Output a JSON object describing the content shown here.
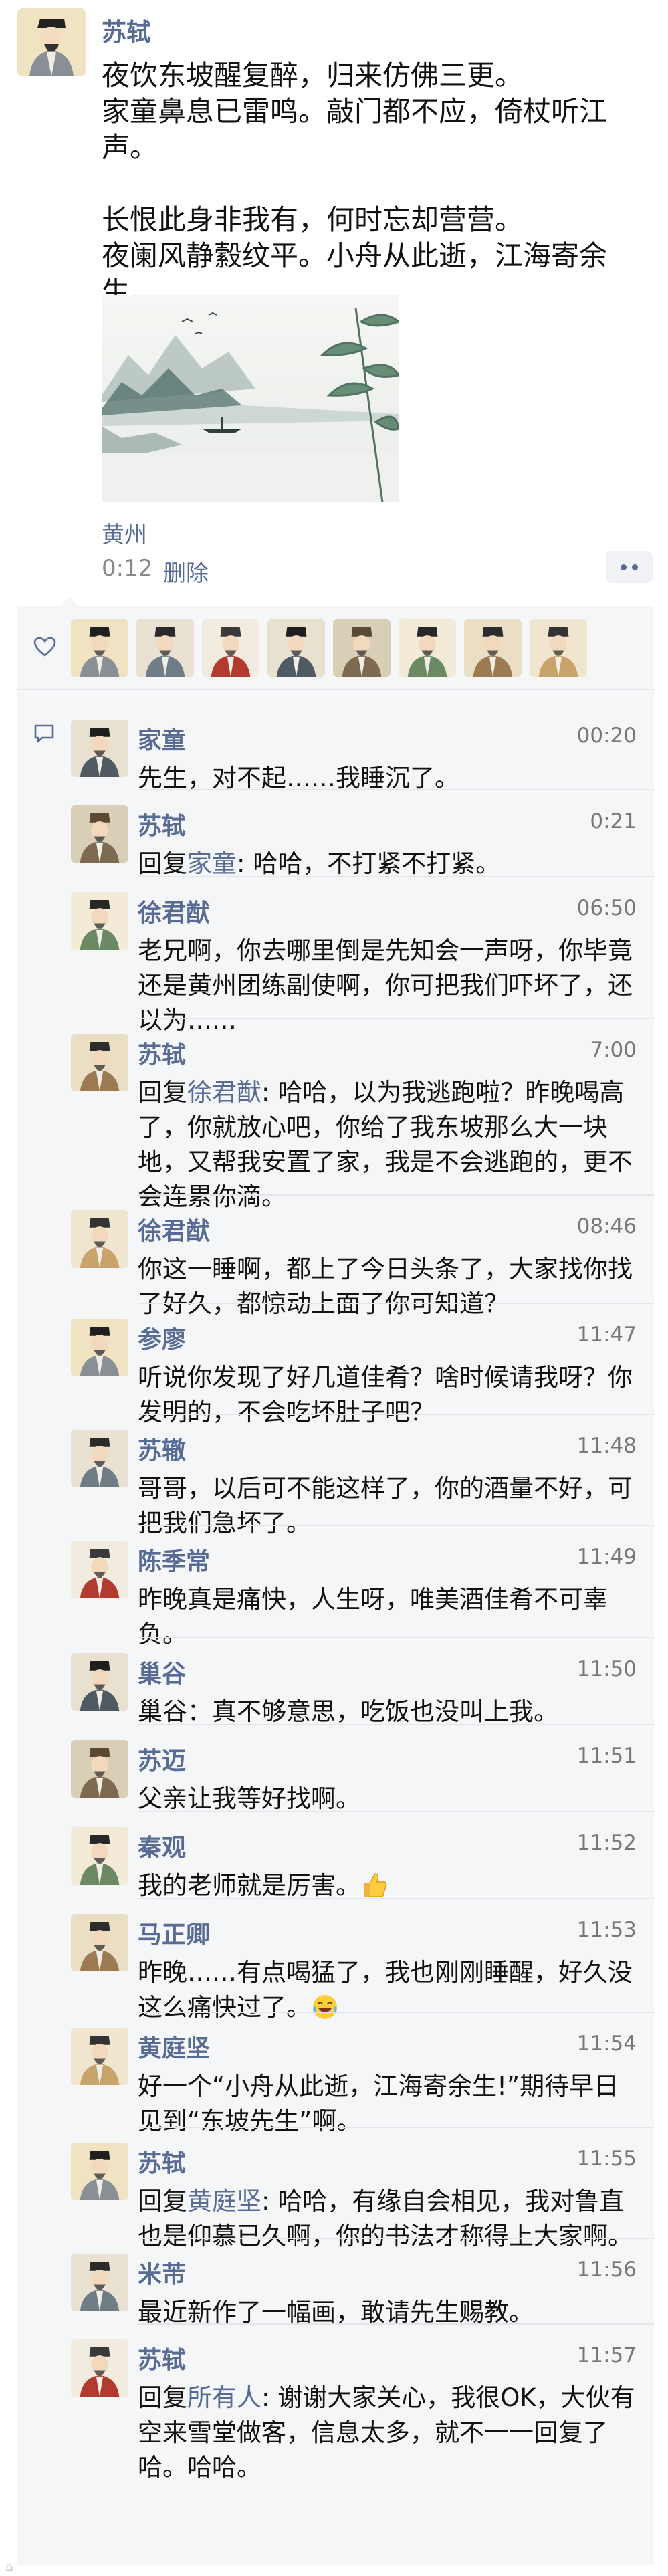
{
  "post": {
    "author": "苏轼",
    "text": "夜饮东坡醒复醉，归来仿佛三更。\n家童鼻息已雷鸣。敲门都不应，倚杖听江声。\n\n长恨此身非我有，何时忘却营营。\n夜阑风静縠纹平。小舟从此逝，江海寄余生。",
    "location": "黄州",
    "time": "0:12",
    "delete_label": "删除"
  },
  "colors": {
    "name_blue": "#576b95",
    "panel_bg": "#f5f6f8",
    "divider": "#e3e5e8"
  },
  "icons": {
    "like": "heart-outline-icon",
    "comment": "comment-bubble-icon",
    "more": "more-dots-icon"
  },
  "likes_count_avatars": 8,
  "comments": [
    {
      "name": "家童",
      "time": "00:20",
      "text": "先生，对不起……我睡沉了。"
    },
    {
      "name": "苏轼",
      "time": "0:21",
      "prefix": "回复",
      "mention": "家童",
      "text": ": 哈哈，不打紧不打紧。"
    },
    {
      "name": "徐君猷",
      "time": "06:50",
      "text": "老兄啊，你去哪里倒是先知会一声呀，你毕竟还是黄州团练副使啊，你可把我们吓坏了，还以为……"
    },
    {
      "name": "苏轼",
      "time": "7:00",
      "prefix": "回复",
      "mention": "徐君猷",
      "text": ": 哈哈，以为我逃跑啦？昨晚喝高了，你就放心吧，你给了我东坡那么大一块地，又帮我安置了家，我是不会逃跑的，更不会连累你滴。"
    },
    {
      "name": "徐君猷",
      "time": "08:46",
      "text": "你这一睡啊，都上了今日头条了，大家找你找了好久，都惊动上面了你可知道？"
    },
    {
      "name": "参廖",
      "time": "11:47",
      "text": "听说你发现了好几道佳肴？啥时候请我呀？你发明的，不会吃坏肚子吧？"
    },
    {
      "name": "苏辙",
      "time": "11:48",
      "text": "哥哥，以后可不能这样了，你的酒量不好，可把我们急坏了。"
    },
    {
      "name": "陈季常",
      "time": "11:49",
      "text": "昨晚真是痛快，人生呀，唯美酒佳肴不可辜负。"
    },
    {
      "name": "巢谷",
      "time": "11:50",
      "text": "巢谷：真不够意思，吃饭也没叫上我。"
    },
    {
      "name": "苏迈",
      "time": "11:51",
      "text": "父亲让我等好找啊。"
    },
    {
      "name": "秦观",
      "time": "11:52",
      "text": "我的老师就是厉害。",
      "emoji": "thumbs-up-icon"
    },
    {
      "name": "马正卿",
      "time": "11:53",
      "text": "昨晚……有点喝猛了，我也刚刚睡醒，好久没这么痛快过了。",
      "emoji": "laughing-tears-icon"
    },
    {
      "name": "黄庭坚",
      "time": "11:54",
      "text": "好一个“小舟从此逝，江海寄余生!”期待早日见到“东坡先生”啊。"
    },
    {
      "name": "苏轼",
      "time": "11:55",
      "prefix": "回复",
      "mention": "黄庭坚",
      "text": ": 哈哈，有缘自会相见，我对鲁直也是仰慕已久啊，你的书法才称得上大家啊。"
    },
    {
      "name": "米芾",
      "time": "11:56",
      "text": "最近新作了一幅画，敢请先生赐教。"
    },
    {
      "name": "苏轼",
      "time": "11:57",
      "prefix": "回复",
      "mention": "所有人",
      "text": ": 谢谢大家关心，我很OK，大伙有空来雪堂做客，信息太多，就不一一回复了哈。哈哈。"
    }
  ]
}
